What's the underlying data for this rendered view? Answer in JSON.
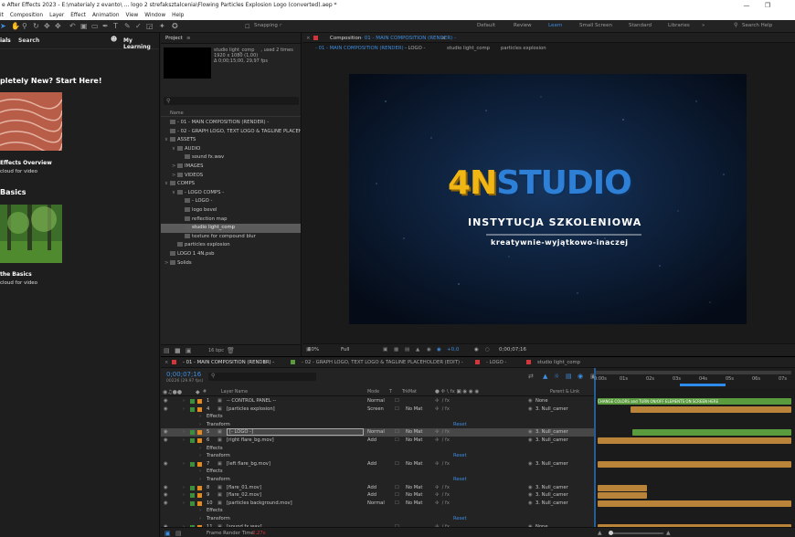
{
  "titlebar": {
    "text": "e After Effects 2023 - E:\\materialy z evanto\\ ... logo 2 strefaksztalcenia\\Flowing Particles Explosion Logo (converted).aep *"
  },
  "menubar": {
    "items": [
      "it",
      "Composition",
      "Layer",
      "Effect",
      "Animation",
      "View",
      "Window",
      "Help"
    ]
  },
  "toolbar": {
    "snapping_label": "Snapping",
    "workspaces": [
      "Default",
      "Review",
      "Learn",
      "Small Screen",
      "Standard",
      "Libraries"
    ],
    "active_workspace": "Learn",
    "search_label": "Search Help",
    "more": "»"
  },
  "learn_panel": {
    "tab_tutorials": "ials",
    "tab_search": "Search",
    "my_learning": "My Learning",
    "heading1": "pletely New? Start Here!",
    "card1_title": "Effects Overview",
    "card1_sub": "cloud for video",
    "heading2": "Basics",
    "card2_title": "the Basics",
    "card2_sub": "cloud for video"
  },
  "project_panel": {
    "title": "Project",
    "preview_name": "studio light_comp",
    "preview_used": ", used 2 times",
    "preview_info1": "1920 x 1080 (1,00)",
    "preview_info2": "Δ 0;00;15;00, 29,97 fps",
    "column_name": "Name",
    "items": [
      {
        "indent": 0,
        "arrow": "",
        "label": "- 01 - MAIN COMPOSITION (RENDER) -",
        "sel": false
      },
      {
        "indent": 0,
        "arrow": "",
        "label": "- 02 - GRAPH LOGO, TEXT LOGO & TAGLINE PLACEH",
        "sel": false
      },
      {
        "indent": 0,
        "arrow": "∨",
        "label": "ASSETS",
        "sel": false
      },
      {
        "indent": 1,
        "arrow": "∨",
        "label": "AUDIO",
        "sel": false
      },
      {
        "indent": 2,
        "arrow": "",
        "label": "sound fx.wav",
        "sel": false
      },
      {
        "indent": 1,
        "arrow": ">",
        "label": "IMAGES",
        "sel": false
      },
      {
        "indent": 1,
        "arrow": ">",
        "label": "VIDEOS",
        "sel": false
      },
      {
        "indent": 0,
        "arrow": "∨",
        "label": "COMPS",
        "sel": false
      },
      {
        "indent": 1,
        "arrow": "∨",
        "label": "- LOGO COMPS -",
        "sel": false
      },
      {
        "indent": 2,
        "arrow": "",
        "label": "- LOGO -",
        "sel": false
      },
      {
        "indent": 2,
        "arrow": "",
        "label": "logo bevel",
        "sel": false
      },
      {
        "indent": 2,
        "arrow": "",
        "label": "reflection map",
        "sel": false
      },
      {
        "indent": 2,
        "arrow": "",
        "label": "studio light_comp",
        "sel": true
      },
      {
        "indent": 2,
        "arrow": "",
        "label": "texture for compound blur",
        "sel": false
      },
      {
        "indent": 1,
        "arrow": "",
        "label": "particles explosion",
        "sel": false
      },
      {
        "indent": 0,
        "arrow": "",
        "label": "LOGO 1 4N.psb",
        "sel": false
      },
      {
        "indent": 0,
        "arrow": ">",
        "label": "Solids",
        "sel": false
      }
    ],
    "bpc": "16 bpc"
  },
  "composition_panel": {
    "title_prefix": "Composition",
    "title_name": "- 01 - MAIN COMPOSITION (RENDER) -",
    "breadcrumbs": [
      "- 01 - MAIN COMPOSITION (RENDER) -",
      "- LOGO -",
      "studio light_comp",
      "particles explosion"
    ],
    "logo_left": "4N",
    "logo_right": "STUDIO",
    "line1": "INSTYTUCJA SZKOLENIOWA",
    "line2": "kreatywnie-wyjątkowo-inaczej",
    "zoom": "50%",
    "resolution": "Full",
    "exposure": "+0,0",
    "timecode": "0;00;07;16"
  },
  "timeline_panel": {
    "tabs": [
      "- 01 - MAIN COMPOSITION (RENDER) -",
      "- 02 - GRAPH LOGO, TEXT LOGO & TAGLINE PLACEHOLDER (EDIT) -",
      "- LOGO -",
      "studio light_comp"
    ],
    "timecode": "0;00;07;16",
    "frames": "00226 (29.97 fps)",
    "col_layer": "Layer Name",
    "col_mode": "Mode",
    "col_t": "T",
    "col_trkmat": "TrkMat",
    "col_parent": "Parent & Link",
    "ruler": [
      "0:00s",
      "01s",
      "02s",
      "03s",
      "04s",
      "05s",
      "06s",
      "07s"
    ],
    "marker_text": "CHANGE COLORS and TURN ON/OFF ELEMENTS ON SCREEN HERE",
    "render_time_label": "Frame Render Time",
    "render_time_value": "2,27s",
    "layers": [
      {
        "num": "1",
        "name": "-- CONTROL PANEL --",
        "mode": "Normal",
        "trk": "",
        "parent": "None",
        "kind": "layer",
        "sel": false
      },
      {
        "num": "4",
        "name": "[particles explosion]",
        "mode": "Screen",
        "trk": "No Mat",
        "parent": "3. Null_camer",
        "kind": "layer",
        "sel": false
      },
      {
        "num": "",
        "name": "Effects",
        "mode": "",
        "trk": "",
        "parent": "",
        "kind": "sub",
        "sel": false
      },
      {
        "num": "",
        "name": "Transform",
        "mode": "",
        "trk": "",
        "parent": "",
        "kind": "reset",
        "sel": false
      },
      {
        "num": "5",
        "name": "[- LOGO -]",
        "mode": "Normal",
        "trk": "No Mat",
        "parent": "3. Null_camer",
        "kind": "layer",
        "sel": true
      },
      {
        "num": "6",
        "name": "[right flare_bg.mov]",
        "mode": "Add",
        "trk": "No Mat",
        "parent": "3. Null_camer",
        "kind": "layer",
        "sel": false
      },
      {
        "num": "",
        "name": "Effects",
        "mode": "",
        "trk": "",
        "parent": "",
        "kind": "sub",
        "sel": false
      },
      {
        "num": "",
        "name": "Transform",
        "mode": "",
        "trk": "",
        "parent": "",
        "kind": "reset",
        "sel": false
      },
      {
        "num": "7",
        "name": "[left flare_bg.mov]",
        "mode": "Add",
        "trk": "No Mat",
        "parent": "3. Null_camer",
        "kind": "layer",
        "sel": false
      },
      {
        "num": "",
        "name": "Effects",
        "mode": "",
        "trk": "",
        "parent": "",
        "kind": "sub",
        "sel": false
      },
      {
        "num": "",
        "name": "Transform",
        "mode": "",
        "trk": "",
        "parent": "",
        "kind": "reset",
        "sel": false
      },
      {
        "num": "8",
        "name": "[flare_01.mov]",
        "mode": "Add",
        "trk": "No Mat",
        "parent": "3. Null_camer",
        "kind": "layer",
        "sel": false
      },
      {
        "num": "9",
        "name": "[flare_02.mov]",
        "mode": "Add",
        "trk": "No Mat",
        "parent": "3. Null_camer",
        "kind": "layer",
        "sel": false
      },
      {
        "num": "10",
        "name": "[particles background.mov]",
        "mode": "Normal",
        "trk": "No Mat",
        "parent": "3. Null_camer",
        "kind": "layer",
        "sel": false
      },
      {
        "num": "",
        "name": "Effects",
        "mode": "",
        "trk": "",
        "parent": "",
        "kind": "sub",
        "sel": false
      },
      {
        "num": "",
        "name": "Transform",
        "mode": "",
        "trk": "",
        "parent": "",
        "kind": "reset",
        "sel": false
      },
      {
        "num": "11",
        "name": "[sound fx.wav]",
        "mode": "",
        "trk": "",
        "parent": "None",
        "kind": "layer",
        "sel": false
      }
    ],
    "reset_label": "Reset"
  },
  "colors": {
    "accent": "#2d8ceb",
    "logo_gold": "#f2b614",
    "logo_blue": "#2e7fd6",
    "label_orange": "#e58a1f",
    "label_red": "#d2363b",
    "bar_orange": "#b9843a",
    "bar_green": "#5a9b3e"
  }
}
